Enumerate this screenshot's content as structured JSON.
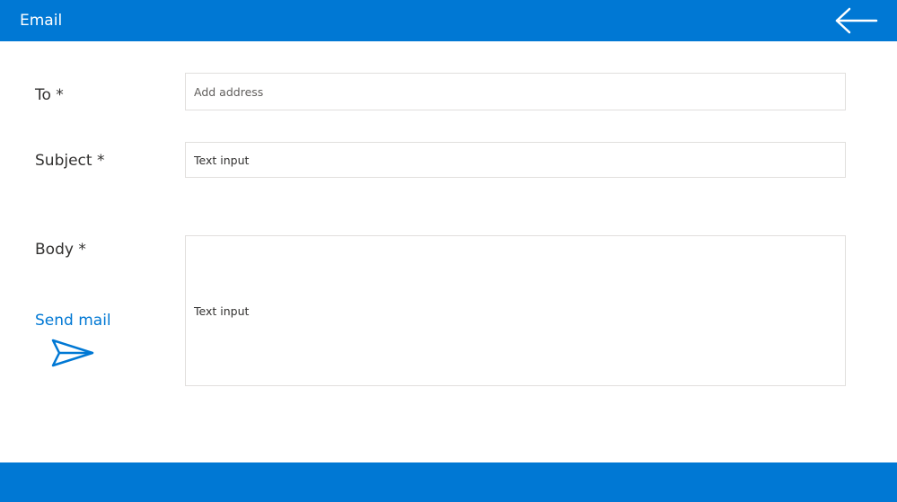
{
  "header": {
    "title": "Email",
    "back_icon": "arrow-left-icon",
    "color": "#0078d4"
  },
  "form": {
    "to": {
      "label": "To *",
      "placeholder": "Add address",
      "value": ""
    },
    "subject": {
      "label": "Subject *",
      "value": "Text input"
    },
    "body": {
      "label": "Body *",
      "value": "Text input"
    }
  },
  "actions": {
    "send_label": "Send mail",
    "send_icon": "send-icon"
  }
}
